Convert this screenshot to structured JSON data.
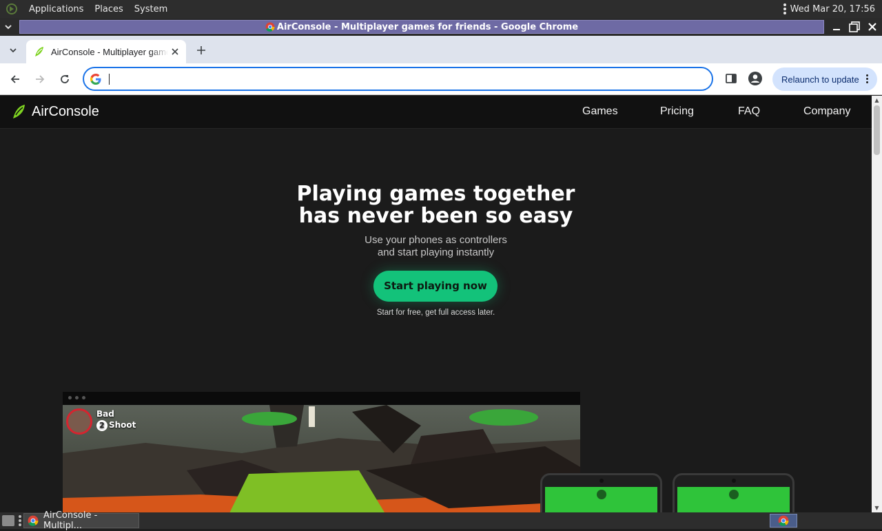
{
  "top_panel": {
    "menus": [
      "Applications",
      "Places",
      "System"
    ],
    "clock": "Wed Mar 20, 17:56"
  },
  "window": {
    "title": "AirConsole - Multiplayer games for friends - Google Chrome"
  },
  "browser": {
    "tab_title": "AirConsole - Multiplayer games for friends",
    "omnibox_value": "",
    "relaunch_label": "Relaunch to update"
  },
  "site": {
    "brand": "AirConsole",
    "nav": [
      "Games",
      "Pricing",
      "FAQ",
      "Company"
    ],
    "hero_title_line1": "Playing games together",
    "hero_title_line2": "has never been so easy",
    "hero_sub_line1": "Use your phones as controllers",
    "hero_sub_line2": "and start playing instantly",
    "cta_label": "Start playing now",
    "cta_note": "Start for free, get full access later.",
    "game_hud": {
      "player1": "Bad",
      "player2_badge": "2",
      "player2": "Shoot"
    }
  },
  "taskbar": {
    "task_label": "AirConsole - Multipl..."
  },
  "colors": {
    "accent": "#13c27a",
    "omnibox_focus": "#1a73e8",
    "titlebar_strip": "#6e6aa4",
    "relaunch_bg": "#d3e3fd"
  }
}
